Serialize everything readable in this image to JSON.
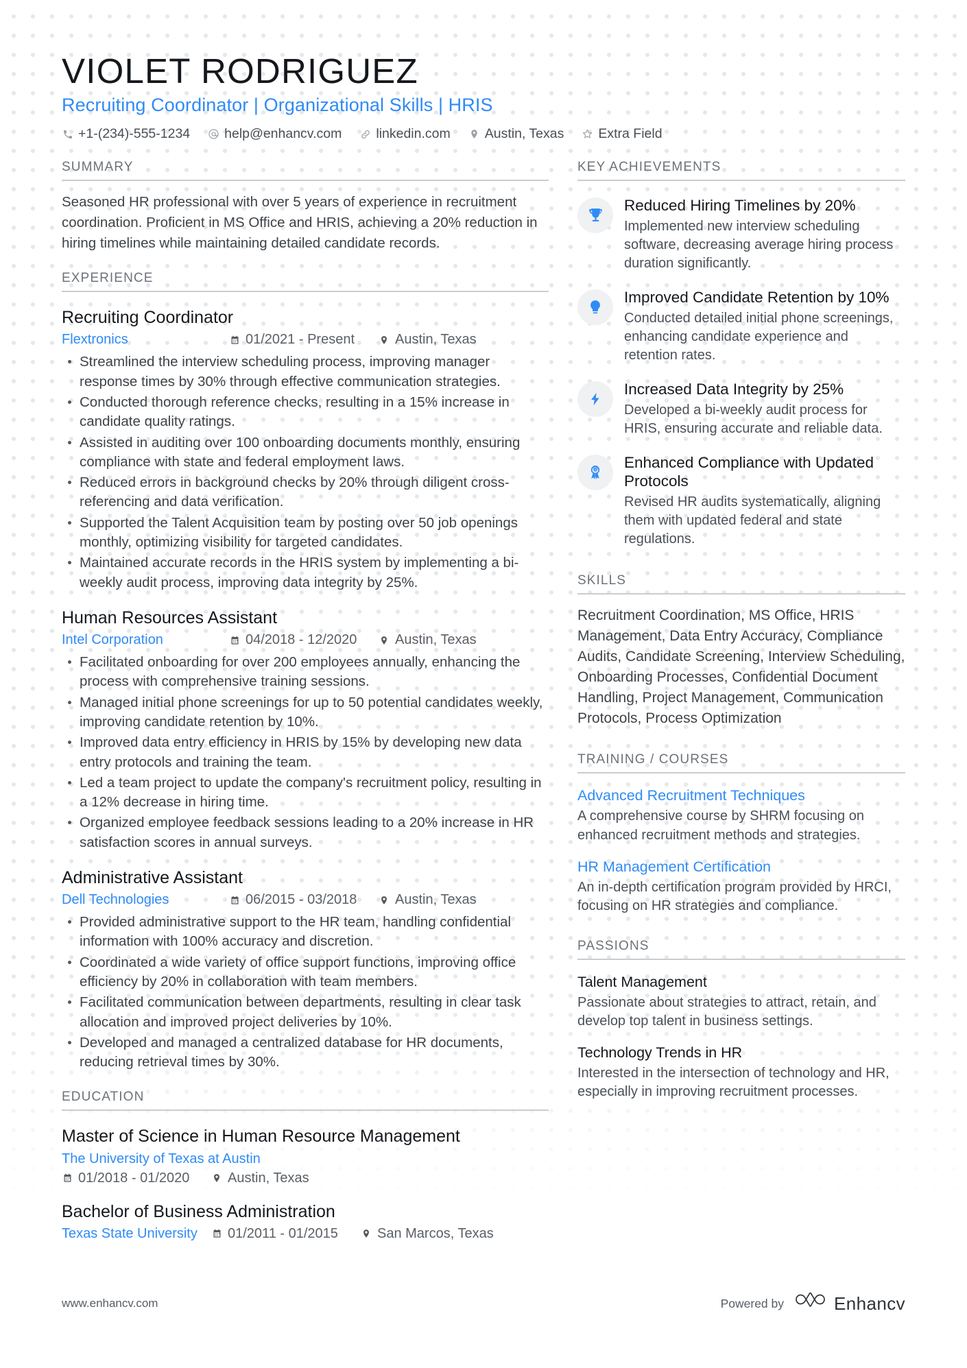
{
  "theme": {
    "accent": "#2f8bf5",
    "text": "#36393d",
    "muted": "#6d7278",
    "rule": "#c9ccd0"
  },
  "header": {
    "name": "VIOLET RODRIGUEZ",
    "headline": "Recruiting Coordinator | Organizational Skills | HRIS",
    "contacts": [
      {
        "icon": "phone-icon",
        "text": "+1-(234)-555-1234"
      },
      {
        "icon": "email-icon",
        "text": "help@enhancv.com"
      },
      {
        "icon": "link-icon",
        "text": "linkedin.com"
      },
      {
        "icon": "location-icon",
        "text": "Austin, Texas"
      },
      {
        "icon": "star-icon",
        "text": "Extra Field"
      }
    ]
  },
  "summary": {
    "section_title": "SUMMARY",
    "text": "Seasoned HR professional with over 5 years of experience in recruitment coordination. Proficient in MS Office and HRIS, achieving a 20% reduction in hiring timelines while maintaining detailed candidate records."
  },
  "experience": {
    "section_title": "EXPERIENCE",
    "entries": [
      {
        "title": "Recruiting Coordinator",
        "company": "Flextronics",
        "date": "01/2021 - Present",
        "location": "Austin, Texas",
        "bullets": [
          "Streamlined the interview scheduling process, improving manager response times by 30% through effective communication strategies.",
          "Conducted thorough reference checks, resulting in a 15% increase in candidate quality ratings.",
          "Assisted in auditing over 100 onboarding documents monthly, ensuring compliance with state and federal employment laws.",
          "Reduced errors in background checks by 20% through diligent cross-referencing and data verification.",
          "Supported the Talent Acquisition team by posting over 50 job openings monthly, optimizing visibility for targeted candidates.",
          "Maintained accurate records in the HRIS system by implementing a bi-weekly audit process, improving data integrity by 25%."
        ]
      },
      {
        "title": "Human Resources Assistant",
        "company": "Intel Corporation",
        "date": "04/2018 - 12/2020",
        "location": "Austin, Texas",
        "bullets": [
          "Facilitated onboarding for over 200 employees annually, enhancing the process with comprehensive training sessions.",
          "Managed initial phone screenings for up to 50 potential candidates weekly, improving candidate retention by 10%.",
          "Improved data entry efficiency in HRIS by 15% by developing new data entry protocols and training the team.",
          "Led a team project to update the company's recruitment policy, resulting in a 12% decrease in hiring time.",
          "Organized employee feedback sessions leading to a 20% increase in HR satisfaction scores in annual surveys."
        ]
      },
      {
        "title": "Administrative Assistant",
        "company": "Dell Technologies",
        "date": "06/2015 - 03/2018",
        "location": "Austin, Texas",
        "bullets": [
          "Provided administrative support to the HR team, handling confidential information with 100% accuracy and discretion.",
          "Coordinated a wide variety of office support functions, improving office efficiency by 20% in collaboration with team members.",
          "Facilitated communication between departments, resulting in clear task allocation and improved project deliveries by 10%.",
          "Developed and managed a centralized database for HR documents, reducing retrieval times by 30%."
        ]
      }
    ]
  },
  "education": {
    "section_title": "EDUCATION",
    "entries": [
      {
        "degree": "Master of Science in Human Resource Management",
        "school": "The University of Texas at Austin",
        "date": "01/2018 - 01/2020",
        "location": "Austin, Texas",
        "inline": false
      },
      {
        "degree": "Bachelor of Business Administration",
        "school": "Texas State University",
        "date": "01/2011 - 01/2015",
        "location": "San Marcos, Texas",
        "inline": true
      }
    ]
  },
  "key_achievements": {
    "section_title": "KEY ACHIEVEMENTS",
    "items": [
      {
        "icon": "trophy-icon",
        "title": "Reduced Hiring Timelines by 20%",
        "desc": "Implemented new interview scheduling software, decreasing average hiring process duration significantly."
      },
      {
        "icon": "lightbulb-icon",
        "title": "Improved Candidate Retention by 10%",
        "desc": "Conducted detailed initial phone screenings, enhancing candidate experience and retention rates."
      },
      {
        "icon": "lightning-icon",
        "title": "Increased Data Integrity by 25%",
        "desc": "Developed a bi-weekly audit process for HRIS, ensuring accurate and reliable data."
      },
      {
        "icon": "award-ribbon-icon",
        "title": "Enhanced Compliance with Updated Protocols",
        "desc": "Revised HR audits systematically, aligning them with updated federal and state regulations."
      }
    ]
  },
  "skills": {
    "section_title": "SKILLS",
    "text": "Recruitment Coordination, MS Office, HRIS Management, Data Entry Accuracy, Compliance Audits, Candidate Screening, Interview Scheduling, Onboarding Processes, Confidential Document Handling, Project Management, Communication Protocols, Process Optimization"
  },
  "training": {
    "section_title": "TRAINING / COURSES",
    "items": [
      {
        "title": "Advanced Recruitment Techniques",
        "desc": "A comprehensive course by SHRM focusing on enhanced recruitment methods and strategies."
      },
      {
        "title": "HR Management Certification",
        "desc": "An in-depth certification program provided by HRCI, focusing on HR strategies and compliance."
      }
    ]
  },
  "passions": {
    "section_title": "PASSIONS",
    "items": [
      {
        "title": "Talent Management",
        "desc": "Passionate about strategies to attract, retain, and develop top talent in business settings."
      },
      {
        "title": "Technology Trends in HR",
        "desc": "Interested in the intersection of technology and HR, especially in improving recruitment processes."
      }
    ]
  },
  "footer": {
    "url": "www.enhancv.com",
    "powered_by": "Powered by",
    "brand": "Enhancv"
  }
}
